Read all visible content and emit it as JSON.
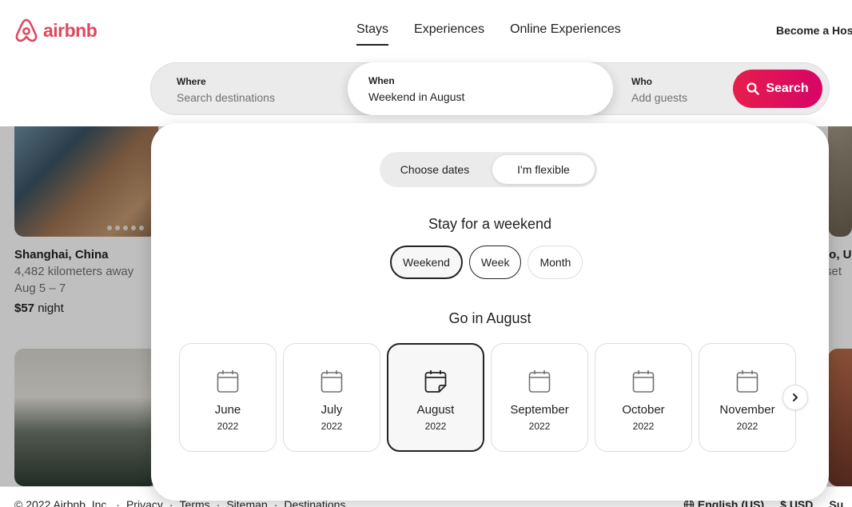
{
  "header": {
    "logo_text": "airbnb",
    "tabs": [
      {
        "label": "Stays"
      },
      {
        "label": "Experiences"
      },
      {
        "label": "Online Experiences"
      }
    ],
    "host_link": "Become a Host"
  },
  "search": {
    "where_label": "Where",
    "where_placeholder": "Search destinations",
    "when_label": "When",
    "when_value": "Weekend in August",
    "who_label": "Who",
    "who_placeholder": "Add guests",
    "button_label": "Search"
  },
  "listings": [
    {
      "title": "Shanghai, China",
      "distance": "4,482 kilometers away",
      "dates": "Aug 5 – 7",
      "price": "$57",
      "price_unit": "night"
    }
  ],
  "right_listing": {
    "title": "lo, U",
    "sub": "set"
  },
  "panel": {
    "toggle_options": [
      "Choose dates",
      "I'm flexible"
    ],
    "stay_heading": "Stay for a weekend",
    "durations": [
      "Weekend",
      "Week",
      "Month"
    ],
    "go_heading": "Go in August",
    "months": [
      {
        "name": "June",
        "year": "2022"
      },
      {
        "name": "July",
        "year": "2022"
      },
      {
        "name": "August",
        "year": "2022"
      },
      {
        "name": "September",
        "year": "2022"
      },
      {
        "name": "October",
        "year": "2022"
      },
      {
        "name": "November",
        "year": "2022"
      }
    ]
  },
  "footer": {
    "copyright": "© 2022 Airbnb, Inc.",
    "links": [
      "Privacy",
      "Terms",
      "Sitemap",
      "Destinations"
    ],
    "language": "English (US)",
    "currency_symbol": "$",
    "currency": "USD",
    "support": "Su"
  },
  "colors": {
    "brand": "#E0475F",
    "search_button": "#E61E4D"
  }
}
